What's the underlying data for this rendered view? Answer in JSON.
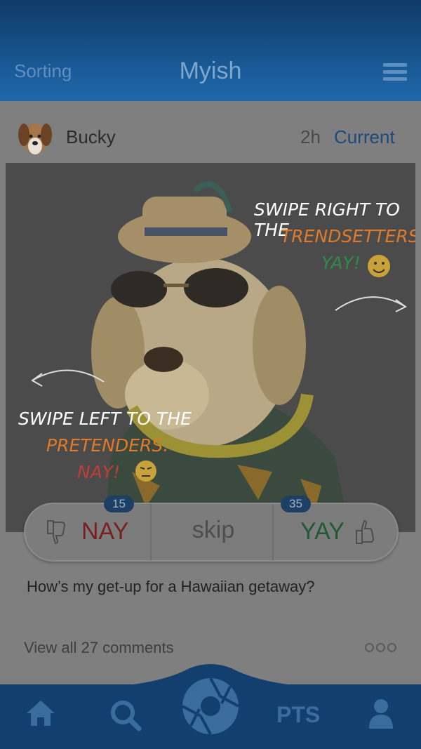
{
  "header": {
    "sorting_label": "Sorting",
    "app_title": "Myish",
    "menu_icon": "hamburger-menu-icon"
  },
  "post": {
    "username": "Bucky",
    "age": "2h",
    "status": "Current",
    "overlay": {
      "right_line1": "SWIPE RIGHT TO THE",
      "right_line2": "TRENDSETTERS.",
      "right_line3": "YAY!",
      "left_line1": "SWIPE LEFT TO THE",
      "left_line2": "PRETENDERS.",
      "left_line3": "NAY!"
    },
    "votes": {
      "nay_label": "NAY",
      "nay_count": "15",
      "skip_label": "skip",
      "yay_label": "YAY",
      "yay_count": "35"
    },
    "caption": "How’s my get-up for a Hawaiian getaway?",
    "comments_link": "View all 27 comments"
  },
  "bottom_nav": {
    "pts_label": "PTS"
  },
  "colors": {
    "header_blue": "#1a5b98",
    "nav_blue": "#123f6d",
    "nay_red": "#c23a3a",
    "yay_green": "#2e8a4a",
    "orange": "#e07a2a"
  }
}
